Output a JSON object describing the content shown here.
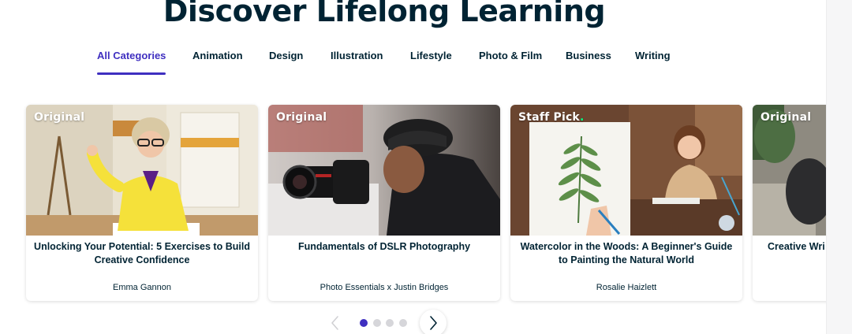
{
  "hero": {
    "title": "Discover Lifelong Learning"
  },
  "tabs": [
    {
      "label": "All Categories",
      "active": true
    },
    {
      "label": "Animation"
    },
    {
      "label": "Design"
    },
    {
      "label": "Illustration"
    },
    {
      "label": "Lifestyle"
    },
    {
      "label": "Photo & Film"
    },
    {
      "label": "Business"
    },
    {
      "label": "Writing"
    }
  ],
  "cards": [
    {
      "badge": "Original",
      "title": "Unlocking Your Potential: 5 Exercises to Build Creative Confidence",
      "author": "Emma Gannon"
    },
    {
      "badge": "Original",
      "title": "Fundamentals of DSLR Photography",
      "author": "Photo Essentials x Justin Bridges"
    },
    {
      "badge": "Staff Pick",
      "badge_dot": ".",
      "title": "Watercolor in the Woods: A Beginner's Guide to Painting the Natural World",
      "author": "Rosalie Haizlett"
    },
    {
      "badge": "Original",
      "title": "Creative Wri"
    }
  ],
  "pager": {
    "pages": 4,
    "current": 1
  },
  "colors": {
    "accent": "#3f2fc0",
    "text": "#002333",
    "staff_pick_dot": "#00ff84"
  }
}
